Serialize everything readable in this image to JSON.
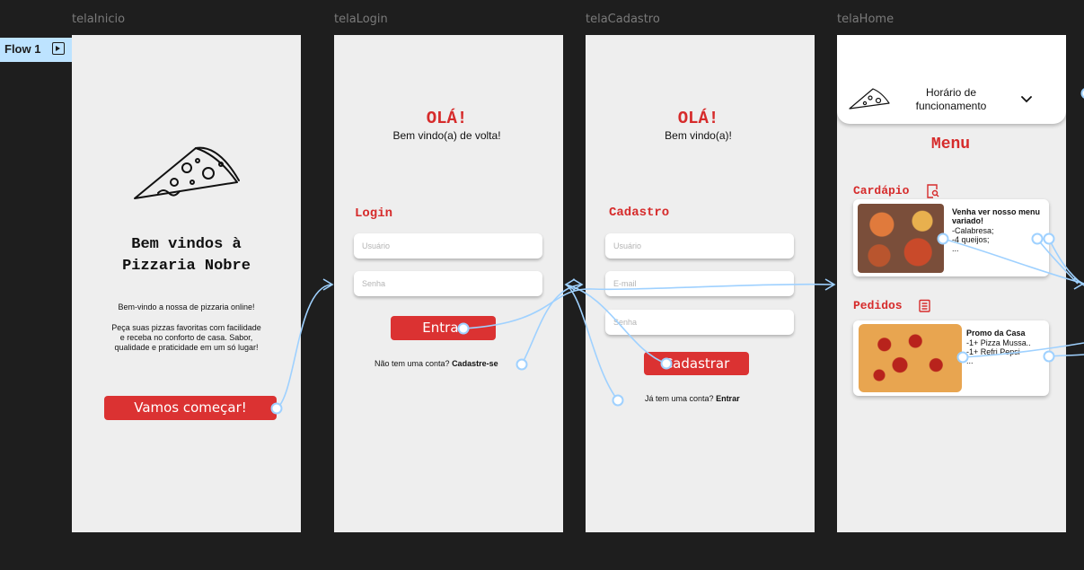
{
  "flow_label": "Flow 1",
  "frames": {
    "inicio": {
      "name": "telaInicio",
      "title": "Bem vindos à Pizzaria Nobre",
      "welcome": "Bem-vindo a nossa de pizzaria online!",
      "description": "Peça suas pizzas favoritas com facilidade e receba no conforto de casa. Sabor, qualidade e praticidade em um só lugar!",
      "button": "Vamos começar!"
    },
    "login": {
      "name": "telaLogin",
      "greeting": "OLÁ!",
      "subtitle": "Bem vindo(a) de volta!",
      "section": "Login",
      "user_placeholder": "Usuário",
      "password_placeholder": "Senha",
      "button": "Entrar",
      "no_account": "Não tem uma conta?",
      "signup_link": "Cadastre-se"
    },
    "cadastro": {
      "name": "telaCadastro",
      "greeting": "OLÁ!",
      "subtitle": "Bem vindo(a)!",
      "section": "Cadastro",
      "user_placeholder": "Usuário",
      "email_placeholder": "E-mail",
      "password_placeholder": "Senha",
      "button": "Cadastrar",
      "has_account": "Já tem uma conta?",
      "login_link": "Entrar"
    },
    "home": {
      "name": "telaHome",
      "hours": "Horário de funcionamento",
      "menu_title": "Menu",
      "cardapio_title": "Cardápio",
      "cardapio_card": {
        "title": "Venha ver nosso menu variado!",
        "lines": [
          "-Calabresa;",
          "-4 queijos;",
          "..."
        ]
      },
      "pedidos_title": "Pedidos",
      "pedidos_card": {
        "title": "Promo da Casa",
        "lines": [
          "-1+ Pizza  Mussa..",
          "-1+ Refri Pepsi",
          "..."
        ]
      }
    }
  },
  "colors": {
    "accent": "#db3232",
    "canvas": "#1e1e1e",
    "frame": "#eeeeee",
    "connector": "#9fd1ff",
    "flow_tag": "#bde3ff"
  }
}
